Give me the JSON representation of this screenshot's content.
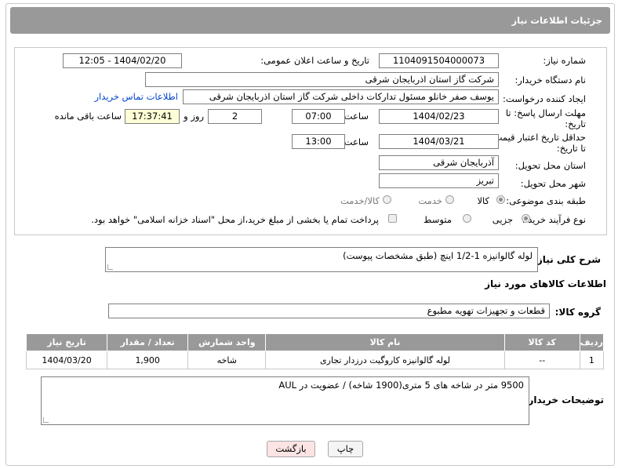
{
  "header": {
    "title": "جزئیات اطلاعات نیاز"
  },
  "form": {
    "need_number": {
      "label": "شماره نیاز:",
      "value": "1104091504000073"
    },
    "announce_datetime": {
      "label": "تاریخ و ساعت اعلان عمومی:",
      "value": "1404/02/20 - 12:05"
    },
    "buyer_org": {
      "label": "نام دستگاه خریدار:",
      "value": "شرکت گاز استان اذربایجان شرقی"
    },
    "requester": {
      "label": "ایجاد کننده درخواست:",
      "value": "یوسف صفر خانلو  مسئول تدارکات داخلی  شرکت گاز استان اذربایجان شرقی",
      "link": "اطلاعات تماس خریدار"
    },
    "deadline": {
      "label_line1": "مهلت ارسال پاسخ: تا",
      "label_line2": "تاریخ:",
      "date": "1404/02/23",
      "time_label": "ساعت",
      "time": "07:00",
      "days": "2",
      "days_label": "روز و",
      "remaining": "17:37:41",
      "remaining_label": "ساعت باقی مانده"
    },
    "price_validity": {
      "label_line1": "حداقل تاریخ اعتبار قیمت:",
      "label_line2": "تا تاریخ:",
      "date": "1404/03/21",
      "time_label": "ساعت",
      "time": "13:00"
    },
    "delivery_province": {
      "label": "استان محل تحویل:",
      "value": "آذربایجان شرقی"
    },
    "delivery_city": {
      "label": "شهر محل تحویل:",
      "value": "تبریز"
    },
    "category": {
      "label": "طبقه بندی موضوعی:",
      "options": [
        "کالا",
        "خدمت",
        "کالا/خدمت"
      ],
      "selected": "کالا"
    },
    "process": {
      "label": "نوع فرآیند خرید :",
      "options": [
        "جزیی",
        "متوسط"
      ],
      "selected": "جزیی",
      "note": "پرداخت تمام یا بخشی از مبلغ خرید،از محل \"اسناد خزانه اسلامی\" خواهد بود."
    }
  },
  "description": {
    "label": "شرح کلی نیاز:",
    "value": "لوله گالوانیزه    1-1/2 اینچ (طبق مشخصات پیوست)"
  },
  "goods_info": {
    "title": "اطلاعات کالاهای مورد نیاز",
    "group_label": "گروه کالا:",
    "group_value": "قطعات و تجهیزات تهویه مطبوع"
  },
  "items_table": {
    "headers": [
      "ردیف",
      "کد کالا",
      "نام کالا",
      "واحد شمارش",
      "تعداد / مقدار",
      "تاریخ نیاز"
    ],
    "rows": [
      [
        "1",
        "--",
        "لوله گالوانیزه کاروگیت درزدار تجاری",
        "شاخه",
        "1,900",
        "1404/03/20"
      ]
    ]
  },
  "buyer_notes": {
    "label": "توضیحات خریدار:",
    "value": "9500 متر در شاخه های 5 متری(1900 شاخه) /  عضویت در AUL"
  },
  "buttons": {
    "print": "چاپ",
    "back": "بازگشت"
  },
  "colors": {
    "header_bg": "#999999",
    "back_btn_bg": "#fde4e4",
    "link": "#0044cc"
  }
}
